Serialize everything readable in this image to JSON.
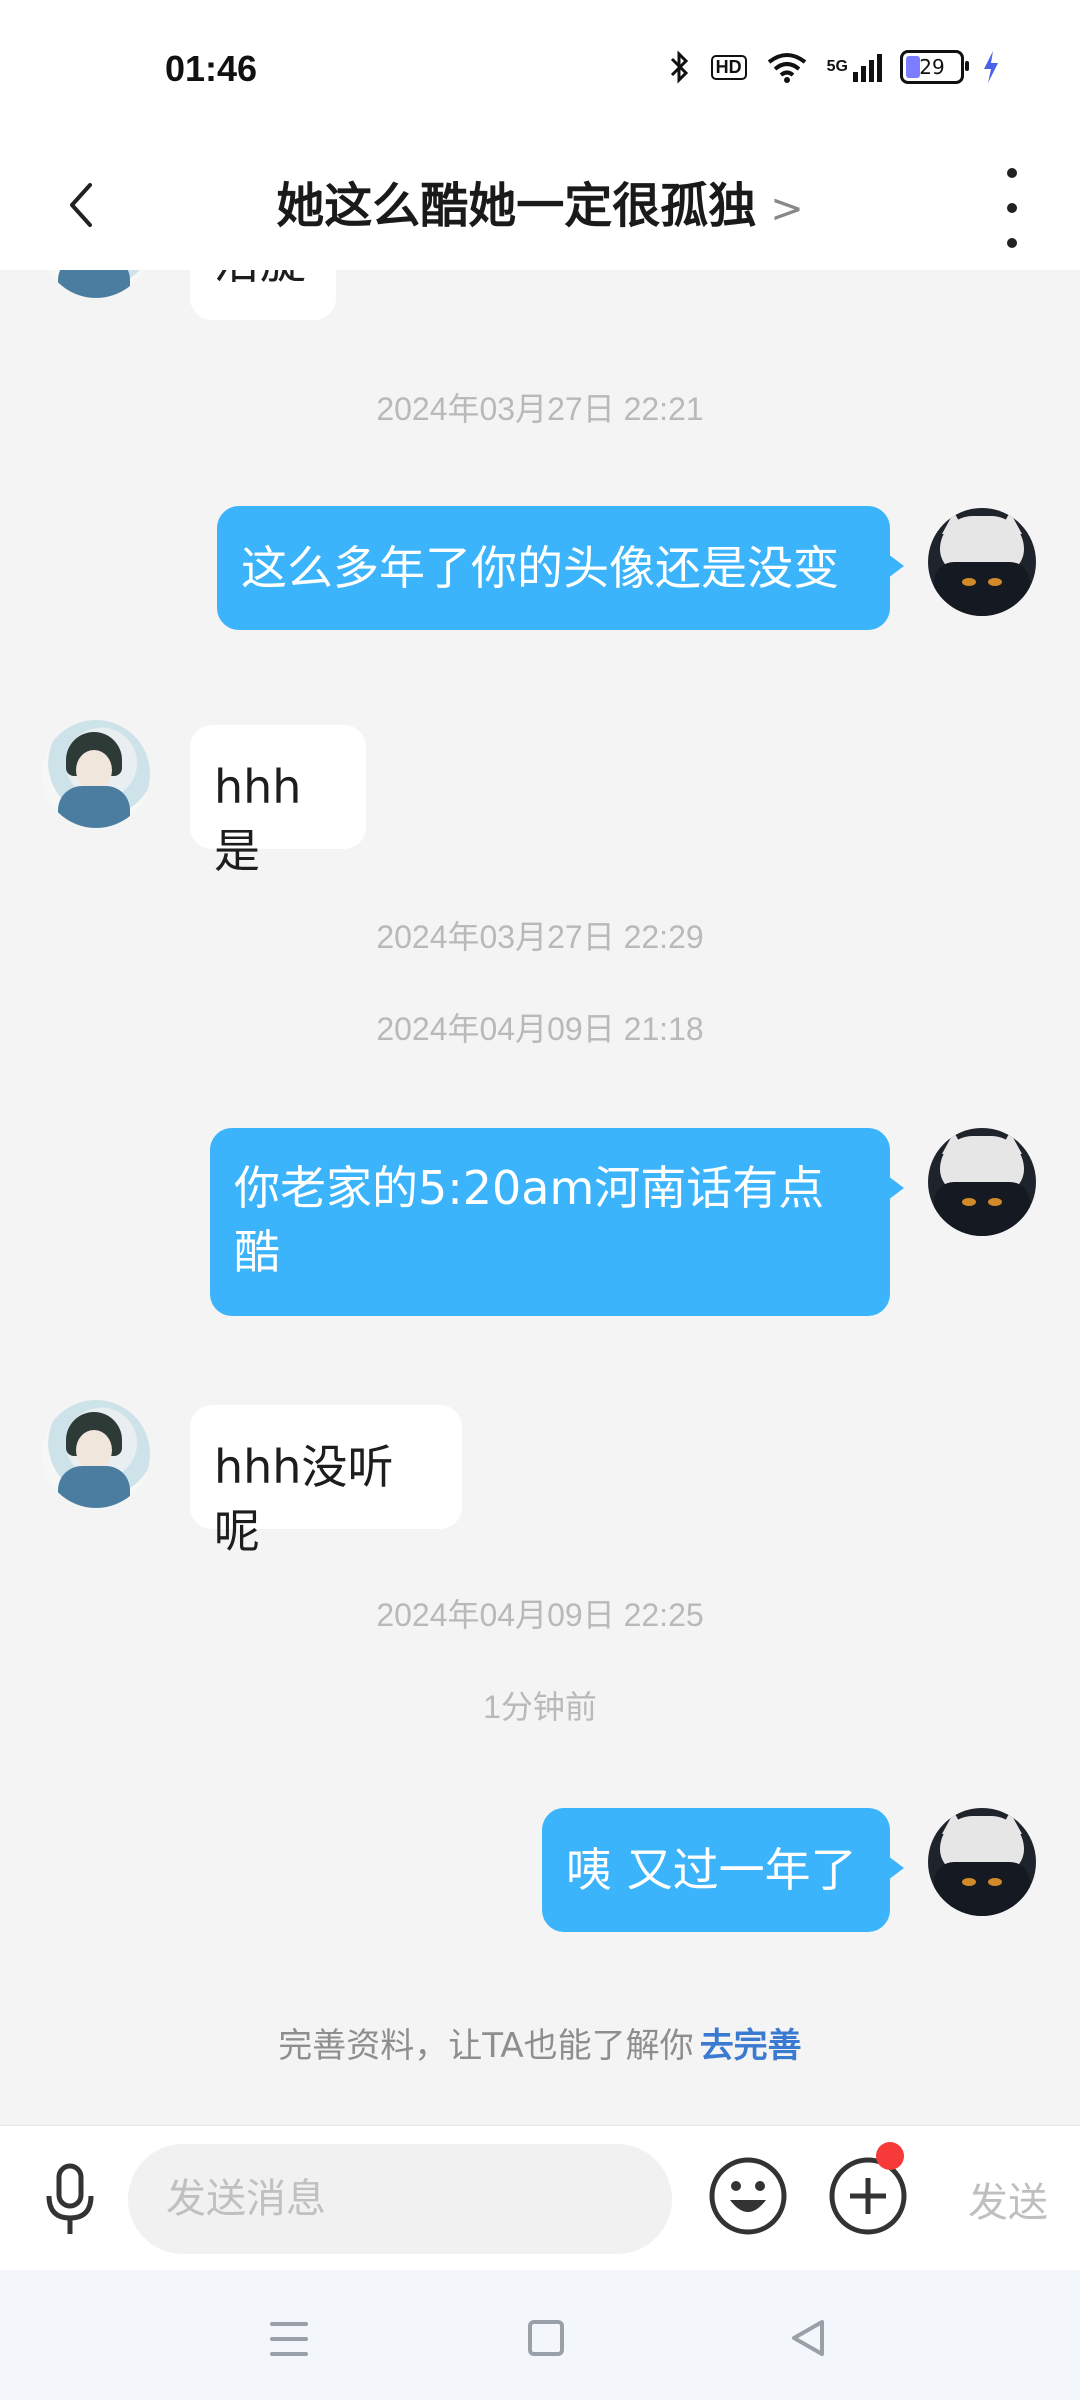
{
  "status_bar": {
    "time": "01:46",
    "battery": "29",
    "network": "5G",
    "hd": "HD"
  },
  "header": {
    "title": "她这么酷她一定很孤独",
    "title_chevron": ">"
  },
  "chat": {
    "partial_bubble_text": "沿旋",
    "timestamps": [
      "2024年03月27日 22:21",
      "2024年03月27日 22:29",
      "2024年04月09日 21:18",
      "2024年04月09日 22:25",
      "1分钟前"
    ],
    "messages": [
      {
        "side": "out",
        "text": "这么多年了你的头像还是没变"
      },
      {
        "side": "in",
        "text": "hhh是"
      },
      {
        "side": "out",
        "text": "你老家的5:20am河南话有点酷"
      },
      {
        "side": "in",
        "text": "hhh没听呢"
      },
      {
        "side": "out",
        "text": "咦 又过一年了"
      }
    ]
  },
  "profile_hint": {
    "text": "完善资料，让TA也能了解你",
    "link": "去完善"
  },
  "composer": {
    "placeholder": "发送消息",
    "send_label": "发送"
  }
}
